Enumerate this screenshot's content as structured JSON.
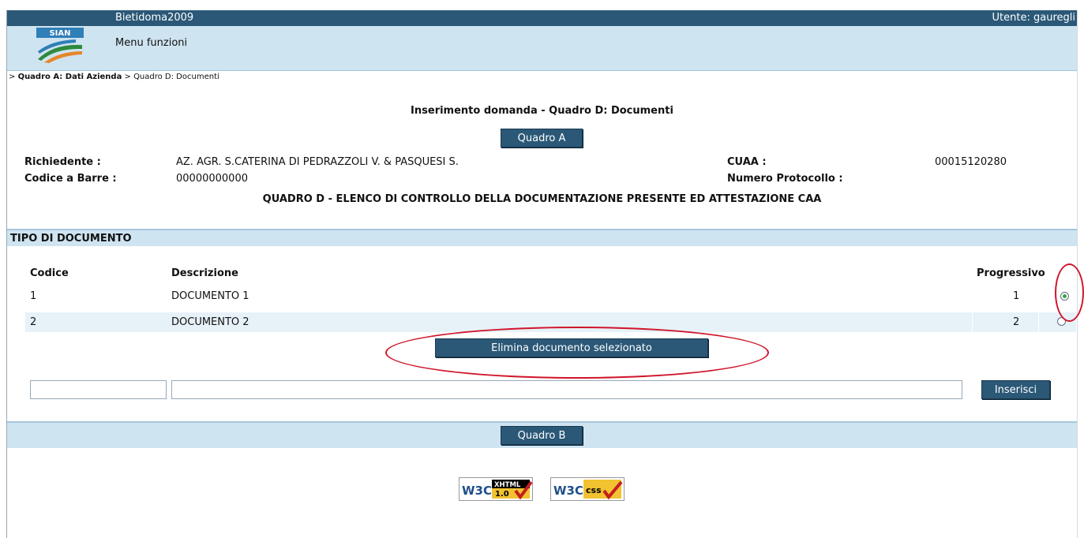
{
  "header": {
    "app_name": "Bietidoma2009",
    "user": "Utente: gauregli",
    "menu": "Menu funzioni",
    "logo_text": "SIAN"
  },
  "breadcrumb": {
    "item1": "Quadro A: Dati Azienda",
    "item2": "Quadro D: Documenti"
  },
  "page_title": "Inserimento domanda - Quadro D: Documenti",
  "buttons": {
    "quadro_a": "Quadro A",
    "elimina": "Elimina documento selezionato",
    "inserisci": "Inserisci",
    "quadro_b": "Quadro B"
  },
  "info": {
    "richiedente_label": "Richiedente :",
    "richiedente_value": "AZ. AGR. S.CATERINA DI PEDRAZZOLI V. & PASQUESI S.",
    "cuaa_label": "CUAA :",
    "cuaa_value": "00015120280",
    "codice_barre_label": "Codice a Barre :",
    "codice_barre_value": "00000000000",
    "protocollo_label": "Numero Protocollo :",
    "protocollo_value": ""
  },
  "section_subtitle": "QUADRO D - ELENCO DI CONTROLLO DELLA DOCUMENTAZIONE PRESENTE ED ATTESTAZIONE CAA",
  "section_header": "TIPO DI DOCUMENTO",
  "table": {
    "columns": [
      "Codice",
      "Descrizione",
      "Progressivo"
    ],
    "rows": [
      {
        "codice": "1",
        "descrizione": "DOCUMENTO 1",
        "progressivo": "1",
        "selected": true
      },
      {
        "codice": "2",
        "descrizione": "DOCUMENTO 2",
        "progressivo": "2",
        "selected": false
      }
    ]
  },
  "new_entry": {
    "codice_value": "",
    "descrizione_value": ""
  },
  "badges": {
    "xhtml": {
      "w3c": "W3C",
      "label": "XHTML",
      "version": "1.0"
    },
    "css": {
      "w3c": "W3C",
      "label": "css"
    }
  },
  "colors": {
    "header_blue": "#2b5877",
    "band_light_blue": "#cfe4f1",
    "annotation_red": "#d0152a",
    "radio_selected": "#3aa14a"
  }
}
